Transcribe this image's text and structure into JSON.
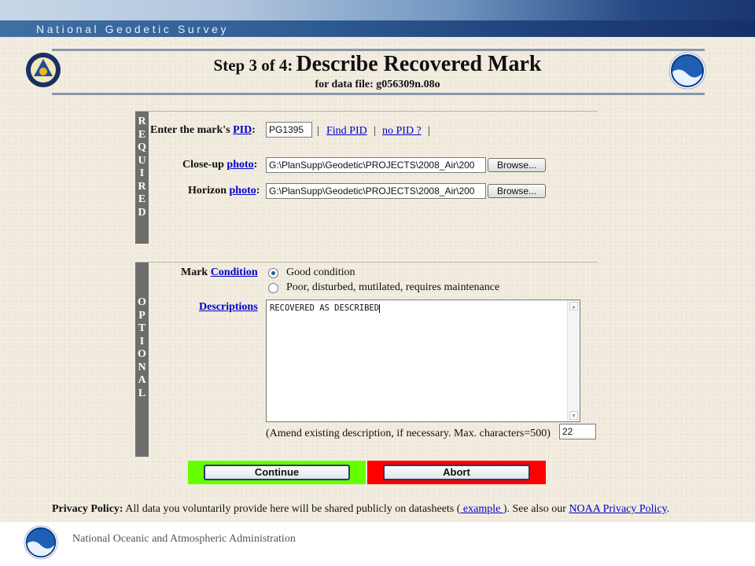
{
  "banner": {
    "title": "National Geodetic Survey"
  },
  "header": {
    "step": "Step 3 of 4:",
    "title": "Describe Recovered Mark",
    "subtitle": "for data file: g056309n.08o"
  },
  "required": {
    "side_label": [
      "R",
      "E",
      "Q",
      "U",
      "I",
      "R",
      "E",
      "D"
    ],
    "pid_label_pre": "Enter the mark's",
    "pid_link": "PID",
    "pid_colon": ":",
    "pid_value": "PG1395",
    "sep1": "|",
    "find_pid": "Find PID",
    "sep2": "|",
    "no_pid": "no PID ?",
    "sep3": "|",
    "closeup_pre": "Close-up",
    "closeup_link": "photo",
    "closeup_colon": ":",
    "closeup_value": "G:\\PlanSupp\\Geodetic\\PROJECTS\\2008_Air\\200",
    "horizon_pre": "Horizon",
    "horizon_link": "photo",
    "horizon_colon": ":",
    "horizon_value": "G:\\PlanSupp\\Geodetic\\PROJECTS\\2008_Air\\200",
    "browse_label": "Browse..."
  },
  "optional": {
    "side_label": [
      "O",
      "P",
      "T",
      "I",
      "O",
      "N",
      "A",
      "L"
    ],
    "condition_pre": "Mark",
    "condition_link": "Condition",
    "option_good": "Good condition",
    "option_poor": "Poor, disturbed, mutilated, requires maintenance",
    "descriptions_link": "Descriptions",
    "description_value": "RECOVERED AS DESCRIBED",
    "amend_note": "(Amend existing description, if necessary. Max. characters=500)",
    "char_count": "22"
  },
  "buttons": {
    "continue": "Continue",
    "abort": "Abort",
    "continue_bg": "#66ff00",
    "abort_bg": "#ff0000"
  },
  "privacy": {
    "label": "Privacy Policy:",
    "text1": " All data you voluntarily provide here will be shared publicly on datasheets (",
    "example": " example ",
    "text2": "). See also our ",
    "noaa_link": "NOAA Privacy Policy",
    "end": "."
  },
  "footer": {
    "text": "National Oceanic and Atmospheric Administration"
  },
  "logos": {
    "left": "ngs-seal-icon",
    "right": "noaa-logo-icon",
    "footer": "noaa-logo-icon"
  }
}
